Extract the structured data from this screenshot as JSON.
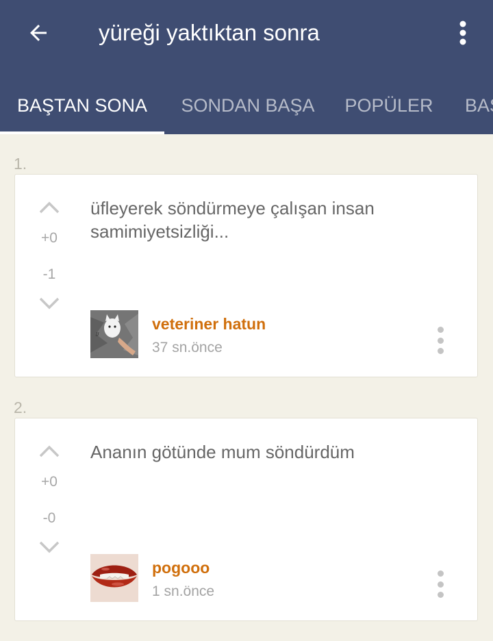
{
  "header": {
    "title": "yüreği yaktıktan sonra",
    "back_icon": "arrow-left-icon",
    "menu_icon": "more-vertical-icon",
    "background": "#3f4d72"
  },
  "tabs": [
    {
      "label": "BAŞTAN SONA",
      "active": true
    },
    {
      "label": "SONDAN BAŞA",
      "active": false
    },
    {
      "label": "POPÜLER",
      "active": false
    },
    {
      "label": "BAŞ",
      "active": false
    }
  ],
  "entries": [
    {
      "index": "1.",
      "upvotes": "+0",
      "downvotes": "-1",
      "text": "üfleyerek söndürmeye çalışan insan samimiyetsizliği...",
      "author": "veteriner hatun",
      "time": "37 sn.önce"
    },
    {
      "index": "2.",
      "upvotes": "+0",
      "downvotes": "-0",
      "text": "Ananın götünde mum söndürdüm",
      "author": "pogooo",
      "time": "1 sn.önce"
    }
  ],
  "colors": {
    "author": "#d06f0c",
    "page_background": "#f3f1e7"
  }
}
